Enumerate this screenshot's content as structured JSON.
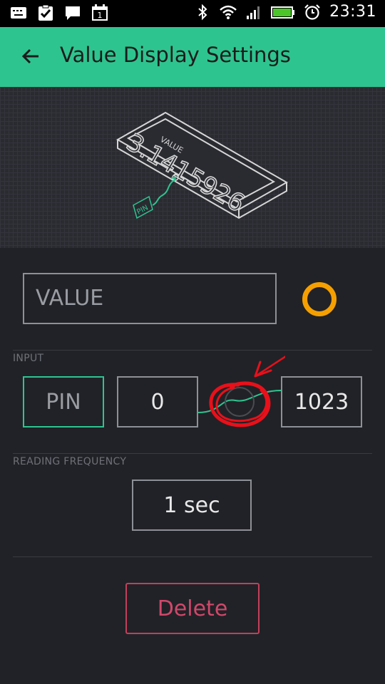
{
  "status_bar": {
    "time": "23:31",
    "left_icons": [
      "keyboard-icon",
      "clipboard-check-icon",
      "message-icon",
      "calendar-icon"
    ],
    "right_icons": [
      "bluetooth-icon",
      "wifi-icon",
      "signal-icon",
      "battery-icon",
      "alarm-icon"
    ],
    "calendar_day": "1"
  },
  "app_bar": {
    "title": "Value Display Settings",
    "color": "#2ec48f"
  },
  "illustration": {
    "widget_label": "VALUE",
    "widget_value": "3.1415926",
    "pin_tag": "PIN"
  },
  "value_field": {
    "value": "VALUE"
  },
  "color_dot": {
    "color": "#f5a000"
  },
  "input_section": {
    "label": "INPUT",
    "pin": "PIN",
    "min": "0",
    "max": "1023"
  },
  "frequency_section": {
    "label": "READING FREQUENCY",
    "value": "1 sec"
  },
  "delete_button": {
    "label": "Delete",
    "color": "#c2405a"
  },
  "annotation": {
    "color": "#e8101a"
  }
}
